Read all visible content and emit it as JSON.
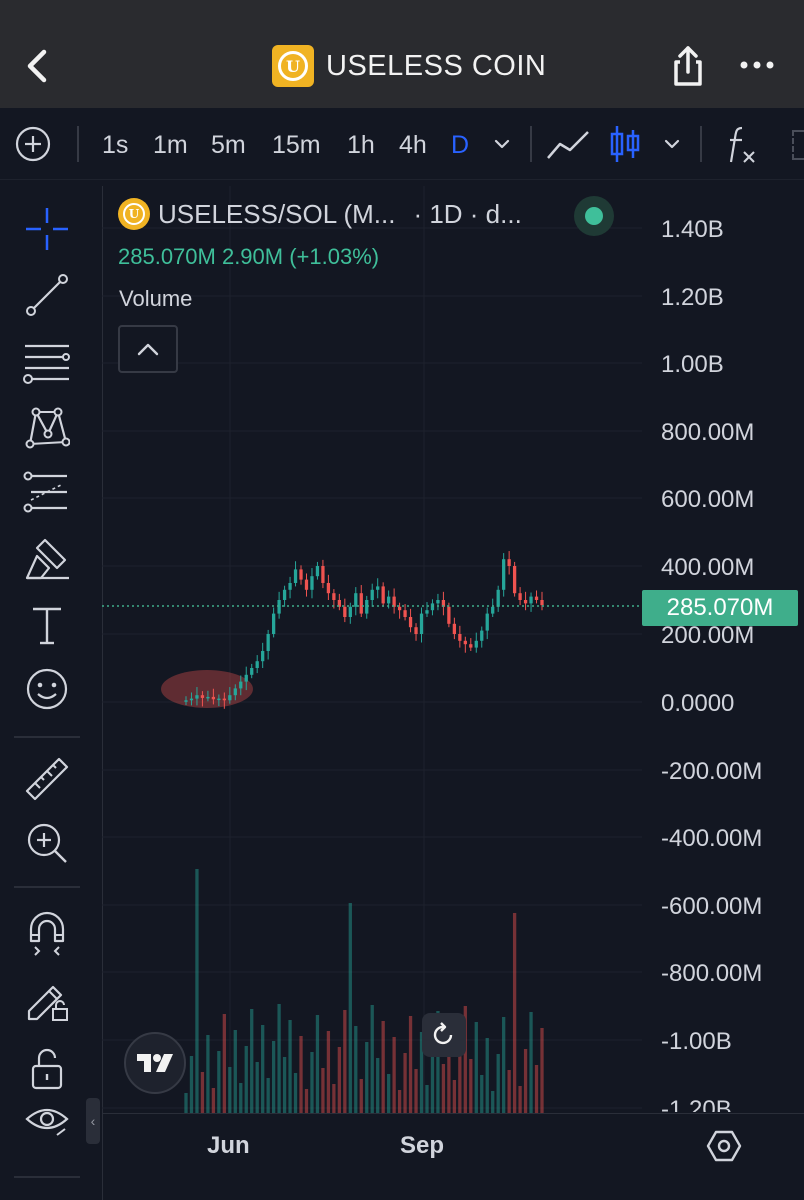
{
  "app": {
    "title": "USELESS COIN",
    "logo_letter": "U",
    "accent": "#f0b323"
  },
  "nav": {
    "back_icon": "chevron-left-icon",
    "share_icon": "share-icon",
    "more_icon": "more-horizontal-icon"
  },
  "toolbar": {
    "timeframes": [
      "1s",
      "1m",
      "5m",
      "15m",
      "1h",
      "4h",
      "D"
    ],
    "active_timeframe": "D",
    "active_color": "#2962ff"
  },
  "sidebar": {
    "tools": [
      "crosshair-icon",
      "trend-line-icon",
      "fib-retracement-icon",
      "pattern-icon",
      "prediction-icon",
      "brush-icon",
      "text-icon",
      "emoji-icon",
      "ruler-icon",
      "zoom-in-icon",
      "magnet-icon",
      "lock-drawing-icon",
      "unlock-icon",
      "eye-icon"
    ]
  },
  "legend": {
    "symbol": "USELESS/SOL (M...",
    "interval": "· 1D · d...",
    "values": "285.070M  2.90M (+1.03%)",
    "volume_label": "Volume",
    "status_color": "#3fbf9a"
  },
  "price_tag": "285.070M",
  "bottom": {
    "reset_icon": "reset-icon",
    "settings_icon": "settings-hexagon-icon",
    "brand_icon": "tradingview-logo-icon"
  },
  "chart_data": {
    "type": "candlestick",
    "y_ticks": [
      "1.40B",
      "1.20B",
      "1.00B",
      "800.00M",
      "600.00M",
      "400.00M",
      "200.00M",
      "0.0000",
      "-200.00M",
      "-400.00M",
      "-600.00M",
      "-800.00M",
      "-1.00B",
      "-1.20B"
    ],
    "x_ticks": [
      "Jun",
      "Sep"
    ],
    "last_price": 285070000,
    "ylim": [
      -1200000000,
      1400000000
    ],
    "up_color": "#26a69a",
    "down_color": "#ef5350",
    "close_series": [
      5,
      10,
      20,
      12,
      15,
      8,
      10,
      5,
      20,
      40,
      60,
      80,
      100,
      120,
      150,
      200,
      260,
      300,
      330,
      350,
      390,
      360,
      330,
      370,
      400,
      350,
      320,
      300,
      280,
      250,
      280,
      320,
      260,
      300,
      330,
      340,
      290,
      310,
      280,
      270,
      250,
      220,
      200,
      260,
      270,
      290,
      300,
      280,
      230,
      200,
      180,
      170,
      160,
      180,
      210,
      260,
      280,
      330,
      420,
      400,
      320,
      300,
      290,
      310,
      300,
      285
    ]
  }
}
